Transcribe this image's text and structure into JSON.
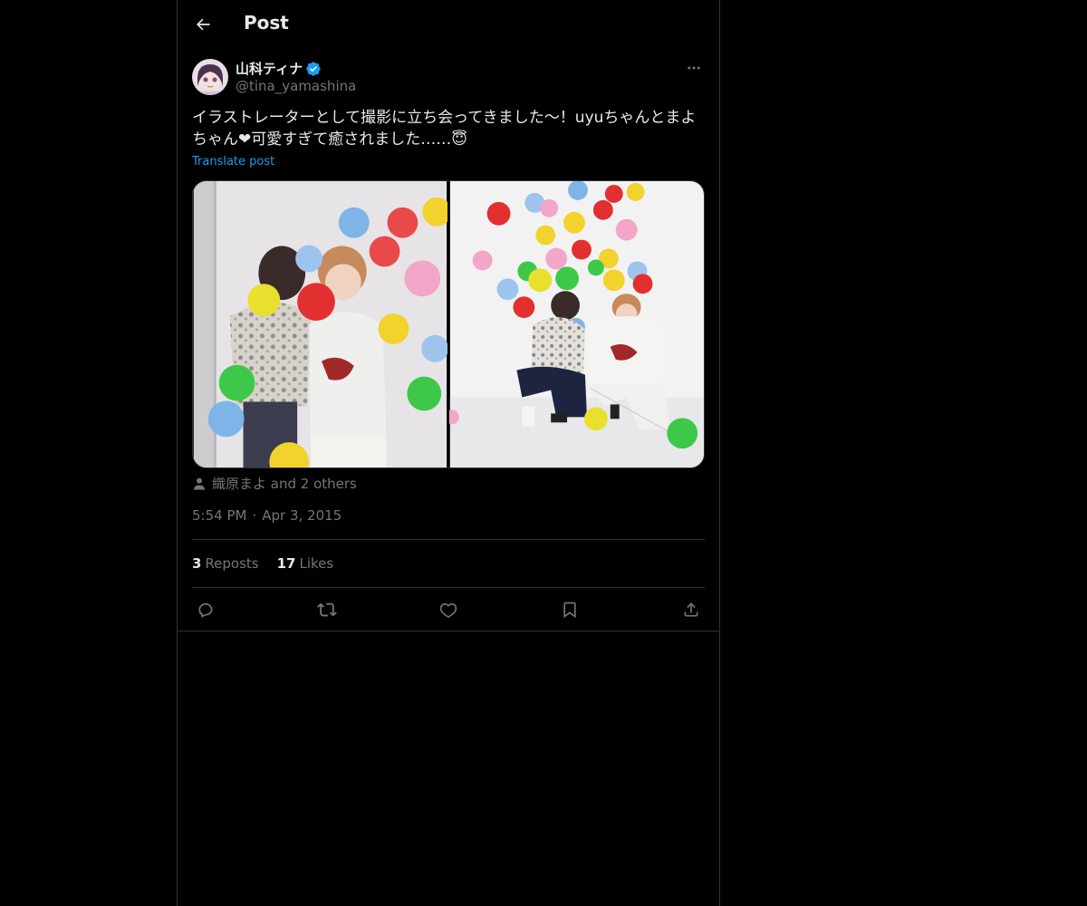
{
  "header": {
    "title": "Post"
  },
  "author": {
    "display_name": "山科ティナ",
    "handle": "@tina_yamashina",
    "verified": true
  },
  "post": {
    "text_line1": "イラストレーターとして撮影に立ち会ってきました〜！uyuちゃんとまよ",
    "text_line2": "ちゃん❤︎可愛すぎて癒されました……",
    "emoji": "😇",
    "translate_label": "Translate post",
    "tagged": "織原まよ and 2 others",
    "time": "5:54 PM",
    "date": "Apr 3, 2015"
  },
  "stats": {
    "reposts_count": "3",
    "reposts_label": "Reposts",
    "likes_count": "17",
    "likes_label": "Likes"
  },
  "icons": {
    "back": "arrow-left-icon",
    "more": "more-horizontal-icon",
    "reply": "reply-icon",
    "repost": "repost-icon",
    "like": "heart-icon",
    "bookmark": "bookmark-icon",
    "share": "share-icon",
    "tag": "person-icon"
  },
  "colors": {
    "accent": "#1d9bf0",
    "background": "#000000",
    "text": "#e7e9ea",
    "muted": "#71767b"
  }
}
